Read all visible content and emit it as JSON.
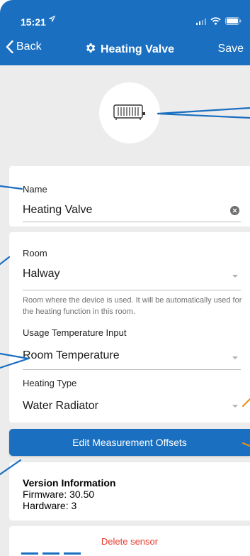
{
  "status_bar": {
    "time": "15:21",
    "location_icon": "location-arrow-icon",
    "signal_icon": "cellular-signal-icon",
    "wifi_icon": "wifi-icon",
    "battery_icon": "battery-icon"
  },
  "nav": {
    "back_label": "Back",
    "title": "Heating Valve",
    "title_icon": "gear-icon",
    "save_label": "Save"
  },
  "device": {
    "icon": "radiator-icon"
  },
  "name_card": {
    "label": "Name",
    "value": "Heating Valve",
    "clear_icon": "clear-icon"
  },
  "room_card": {
    "room_label": "Room",
    "room_value": "Halway",
    "room_hint": "Room where the device is used. It will be automatically used for the heating function in this room.",
    "usage_label": "Usage Temperature Input",
    "usage_value": "Room Temperature",
    "heating_label": "Heating Type",
    "heating_value": "Water Radiator"
  },
  "offsets_button": {
    "label": "Edit Measurement Offsets"
  },
  "version": {
    "title": "Version Information",
    "firmware": "Firmware: 30.50",
    "hardware": "Hardware: 3"
  },
  "delete_button": {
    "label": "Delete sensor"
  },
  "colors": {
    "brand_blue": "#1a6fc0",
    "background": "#ececec",
    "delete_red": "#e53a2f",
    "callout_blue": "#1a6fc0",
    "callout_orange": "#e8901e"
  }
}
